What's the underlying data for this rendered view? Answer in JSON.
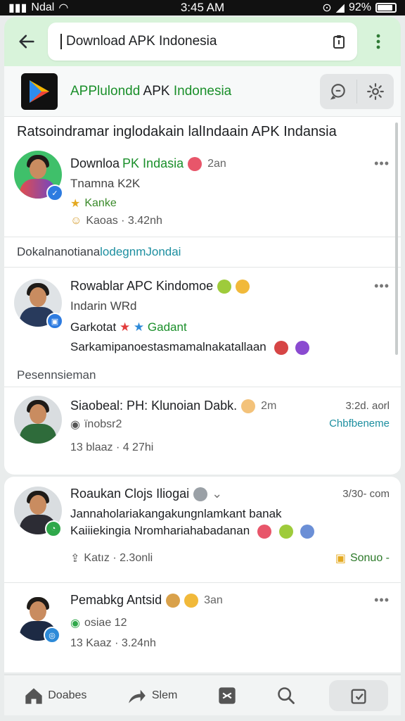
{
  "status": {
    "carrier": "Ndal",
    "time": "3:45 AM",
    "battery": "92%"
  },
  "header": {
    "search_value": "Download APK Indonesia"
  },
  "brand": {
    "title_part1": "APPlulondd ",
    "title_part2": "APK ",
    "title_part3": "Indonesia"
  },
  "feed": {
    "section_title": "Ratsoindramar inglodakain lalIndaain APK Indansia",
    "subsection1_prefix": "Dokalnanotiana ",
    "subsection1_accent": "lodegnmJondai",
    "subsection2": "Pesennsieman",
    "posts": [
      {
        "name": "Downloa",
        "name_green": "PK Indasia",
        "time": "2an",
        "line1": "Tnamna K2K",
        "line2": "Kanke",
        "meta": "Kaoas · 3.42nh"
      },
      {
        "name": "Rowablar APC Kindomoe",
        "line1": "Indarin WRd",
        "line2_a": "Garkotat",
        "line2_b": "Gadant",
        "line3": "Sarkamipanoestasmamalnakatallaan"
      },
      {
        "name": "Siaobeal: PH: Klunoian Dabk.",
        "time": "2m",
        "right_time": "3:2d. aorl",
        "right_label": "Chbfbeneme",
        "line1": "ïnobsr2",
        "meta": "13 blaaz · 4 27hi"
      },
      {
        "name": "Roaukan Clojs Iliogai",
        "right_time": "3/30- com",
        "line1": "Jannaholariakangakungnlamkant banak",
        "line2": "Kaiiiekingia Nromhariahabadanan",
        "meta": "Katız · 2.3onli",
        "action": "Sonuo -"
      },
      {
        "name": "Pemabkg Antsid",
        "time": "3an",
        "line1": "osiae 12",
        "meta": "13 Kaaz · 3.24nh"
      }
    ]
  },
  "nav": {
    "item1": "Doabes",
    "item2": "Slem"
  }
}
